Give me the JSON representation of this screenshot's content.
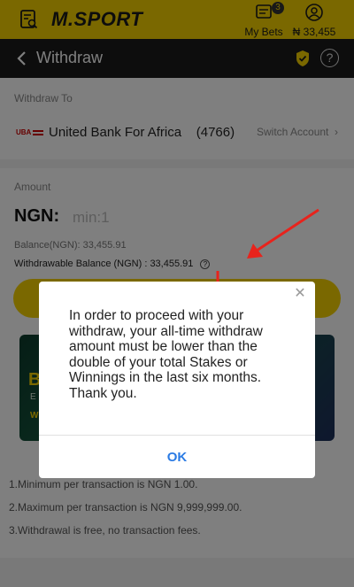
{
  "topbar": {
    "logo": "M.SPORT",
    "my_bets_label": "My Bets",
    "my_bets_count": "3",
    "balance": "₦ 33,455"
  },
  "header": {
    "title": "Withdraw",
    "help_glyph": "?"
  },
  "withdraw_to": {
    "label": "Withdraw To",
    "bank_logo_text": "UBA",
    "bank_name": "United Bank For Africa    (4766)",
    "switch_label": "Switch Account  ›"
  },
  "amount": {
    "label": "Amount",
    "currency": "NGN:",
    "placeholder": "min:1",
    "balance_line": "Balance(NGN): 33,455.91",
    "withdrawable_line": "Withdrawable Balance (NGN) : 33,455.91",
    "info_glyph": "?"
  },
  "promo": {
    "line1": "B",
    "line2": "E",
    "line3": "W"
  },
  "rules": [
    "1.Minimum per transaction is NGN 1.00.",
    "2.Maximum per transaction is NGN 9,999,999.00.",
    "3.Withdrawal is free, no transaction fees."
  ],
  "dialog": {
    "close_glyph": "✕",
    "message": "In order to proceed with your withdraw, your all-time withdraw amount must be lower than the double of your total Stakes or Winnings in the last six months. Thank you.",
    "ok_label": "OK"
  },
  "colors": {
    "brand_yellow": "#f5d100",
    "header_dark": "#1b1b1b",
    "link_blue": "#2b7be4",
    "annotation_red": "#e8231c"
  }
}
